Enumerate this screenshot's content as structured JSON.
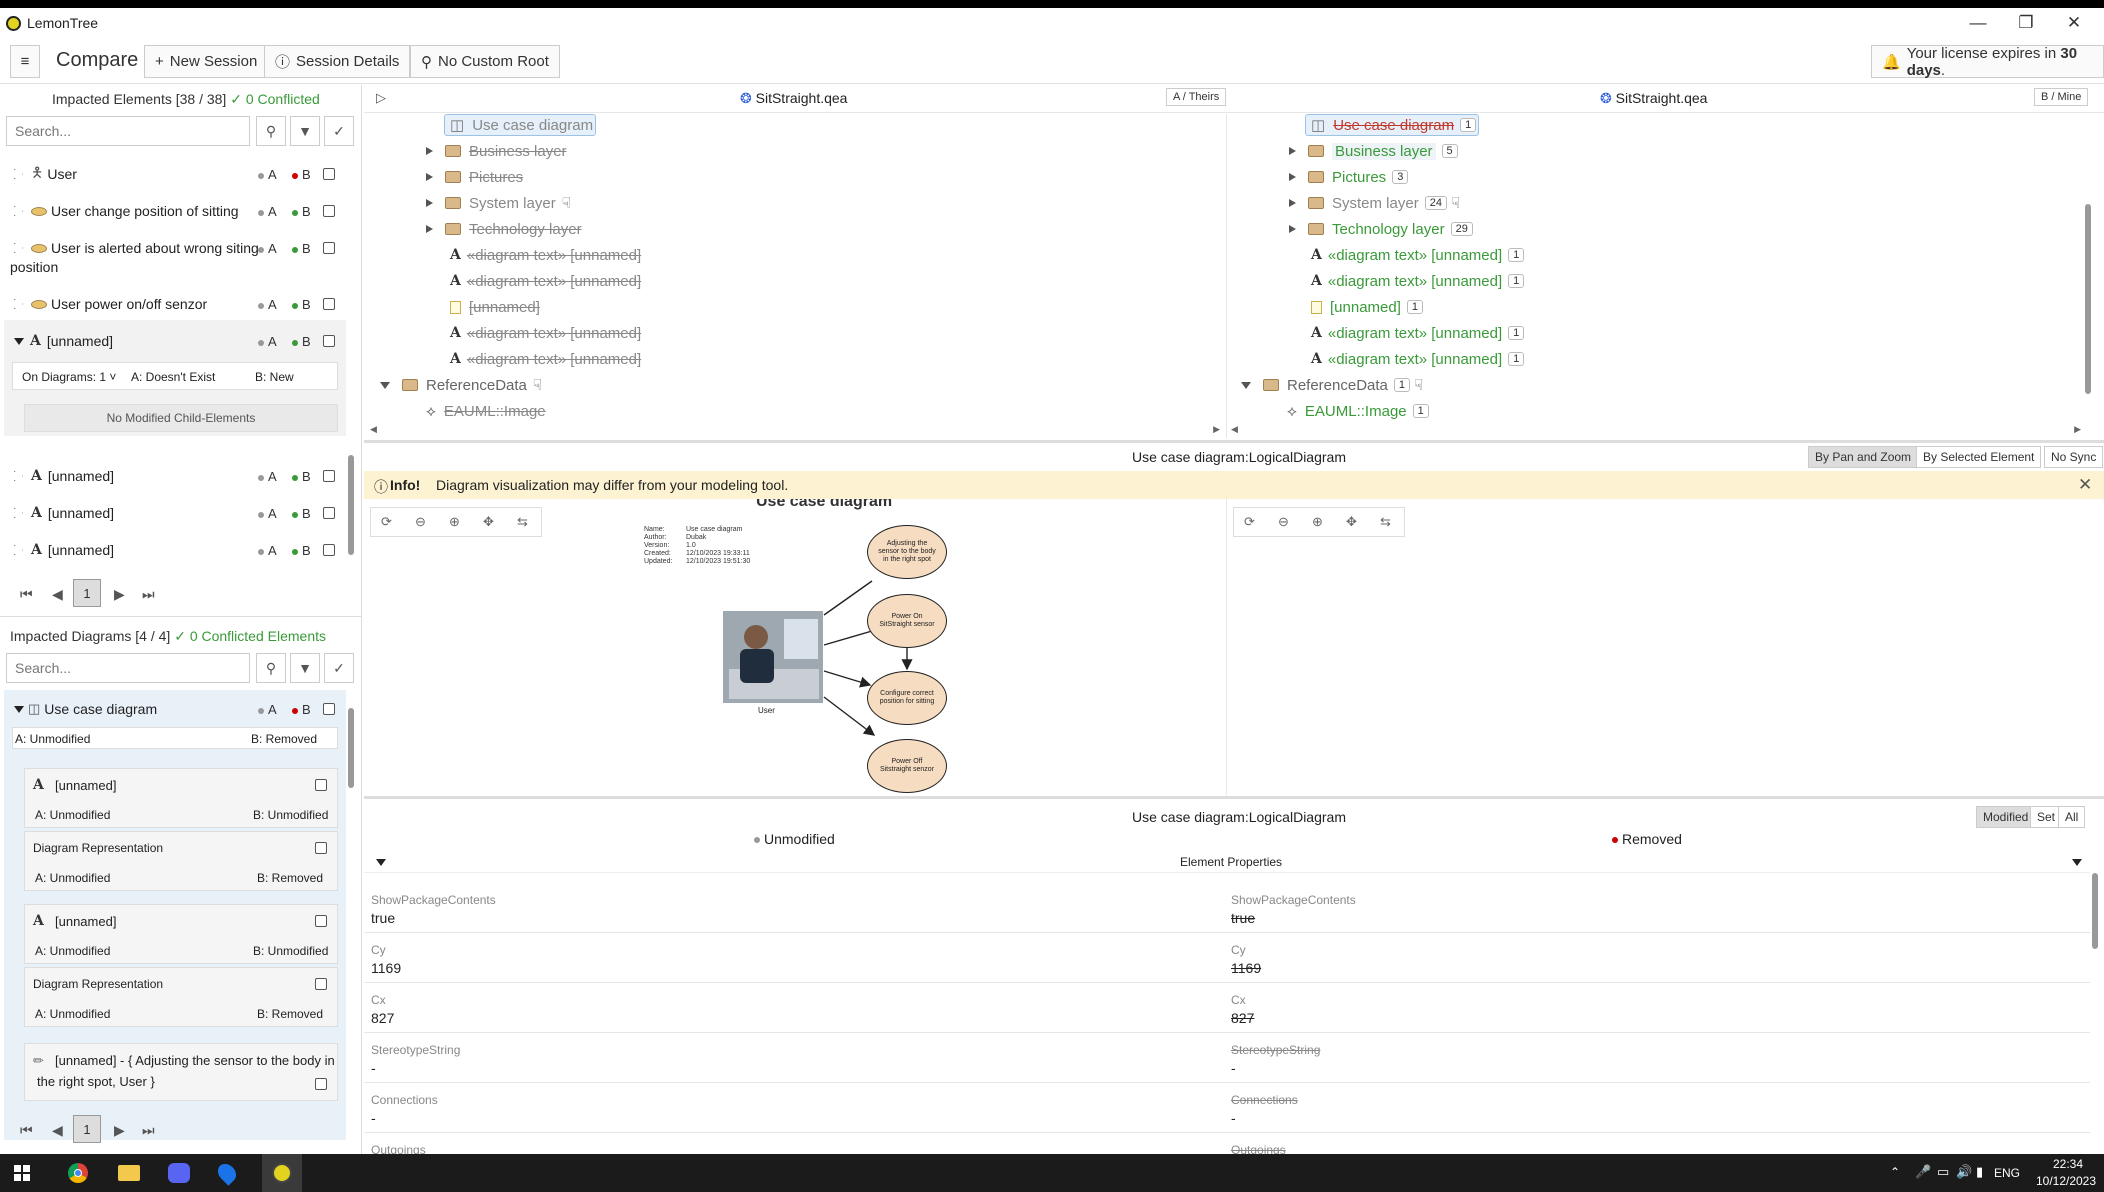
{
  "window": {
    "title": "LemonTree"
  },
  "toolbar": {
    "menu_icon": "hamburger-icon",
    "compare_label": "Compare",
    "new_session_label": "New Session",
    "session_details_label": "Session Details",
    "no_custom_root_label": "No Custom Root",
    "license_prefix": "Your license expires in ",
    "license_days": "30 days",
    "license_suffix": "."
  },
  "elements_panel": {
    "title": "Impacted Elements [38 / 38]",
    "conflicted": "0 Conflicted",
    "search_placeholder": "Search...",
    "items": [
      {
        "name": "User",
        "a": "A",
        "b": "B",
        "b_status": "removed"
      },
      {
        "name": "User change position of sitting",
        "a": "A",
        "b": "B",
        "b_status": "added"
      },
      {
        "name": "User is alerted about wrong siting",
        "name2": "position",
        "a": "A",
        "b": "B",
        "b_status": "added"
      },
      {
        "name": "User power on/off senzor",
        "a": "A",
        "b": "B",
        "b_status": "added"
      },
      {
        "name": "[unnamed]",
        "a": "A",
        "b": "B",
        "b_status": "added"
      }
    ],
    "detail": {
      "on_diagrams": "On Diagrams: 1",
      "a_state": "A: Doesn't Exist",
      "b_state": "B: New",
      "no_children": "No Modified Child-Elements"
    },
    "items2": [
      {
        "name": "[unnamed]",
        "a": "A",
        "b": "B"
      },
      {
        "name": "[unnamed]",
        "a": "A",
        "b": "B"
      },
      {
        "name": "[unnamed]",
        "a": "A",
        "b": "B"
      }
    ],
    "page": "1"
  },
  "diagrams_panel": {
    "title": "Impacted Diagrams [4 / 4]",
    "conflicted": "0 Conflicted Elements",
    "search_placeholder": "Search...",
    "diagram": {
      "name": "Use case diagram",
      "a": "A",
      "b": "B",
      "a_state": "A: Unmodified",
      "b_state": "B: Removed"
    },
    "subitems": [
      {
        "name": "[unnamed]",
        "a_state": "A: Unmodified",
        "b_state": "B: Unmodified"
      },
      {
        "name": "Diagram Representation",
        "a_state": "A: Unmodified",
        "b_state": "B: Removed"
      },
      {
        "name": "[unnamed]",
        "a_state": "A: Unmodified",
        "b_state": "B: Unmodified"
      },
      {
        "name": "Diagram Representation",
        "a_state": "A: Unmodified",
        "b_state": "B: Removed"
      },
      {
        "name": "[unnamed] - { Adjusting the sensor to the body in",
        "name2": "the right spot, User }"
      }
    ],
    "page": "1"
  },
  "left_tree": {
    "file": "SitStraight.qea",
    "tag": "A / Theirs",
    "items": [
      {
        "label": "Use case diagram"
      },
      {
        "label": "Business layer"
      },
      {
        "label": "Pictures"
      },
      {
        "label": "System layer"
      },
      {
        "label": "Technology layer"
      },
      {
        "label": "«diagram text» [unnamed]"
      },
      {
        "label": "«diagram text» [unnamed]"
      },
      {
        "label": "[unnamed]"
      },
      {
        "label": "«diagram text» [unnamed]"
      },
      {
        "label": "«diagram text» [unnamed]"
      },
      {
        "label": "ReferenceData"
      },
      {
        "label": "EAUML::Image"
      }
    ]
  },
  "right_tree": {
    "file": "SitStraight.qea",
    "tag": "B / Mine",
    "items": [
      {
        "label": "Use case diagram",
        "count": "1"
      },
      {
        "label": "Business layer",
        "count": "5"
      },
      {
        "label": "Pictures",
        "count": "3"
      },
      {
        "label": "System layer",
        "count": "24"
      },
      {
        "label": "Technology layer",
        "count": "29"
      },
      {
        "label": "«diagram text» [unnamed]",
        "count": "1"
      },
      {
        "label": "«diagram text» [unnamed]",
        "count": "1"
      },
      {
        "label": "[unnamed]",
        "count": "1"
      },
      {
        "label": "«diagram text» [unnamed]",
        "count": "1"
      },
      {
        "label": "«diagram text» [unnamed]",
        "count": "1"
      },
      {
        "label": "ReferenceData",
        "count": "1"
      },
      {
        "label": "EAUML::Image",
        "count": "1"
      }
    ]
  },
  "diagram_view": {
    "title": "Use case diagram:LogicalDiagram",
    "sync_options": [
      "By Pan and Zoom",
      "By Selected Element",
      "No Sync"
    ],
    "info_label": "Info!",
    "info_text": "Diagram visualization may differ from your modeling tool.",
    "diagram_title": "Use case diagram",
    "meta": [
      {
        "k": "Name:",
        "v": "Use case diagram"
      },
      {
        "k": "Author:",
        "v": "Dubak"
      },
      {
        "k": "Version:",
        "v": "1.0"
      },
      {
        "k": "Created:",
        "v": "12/10/2023 19:33:11"
      },
      {
        "k": "Updated:",
        "v": "12/10/2023 19:51:30"
      }
    ],
    "actor": "User",
    "usecases": [
      "Adjusting the sensor to the body in the right spot",
      "Power On SitStraight sensor",
      "Configure correct position for sitting",
      "Power Off Sitstraight senzor"
    ]
  },
  "properties": {
    "title": "Use case diagram:LogicalDiagram",
    "filter_options": [
      "Modified",
      "Set",
      "All"
    ],
    "left_status": "Unmodified",
    "right_status": "Removed",
    "section": "Element Properties",
    "rows": [
      {
        "name": "ShowPackageContents",
        "left": "true",
        "right": "true"
      },
      {
        "name": "Cy",
        "left": "1169",
        "right": "1169"
      },
      {
        "name": "Cx",
        "left": "827",
        "right": "827"
      },
      {
        "name": "StereotypeString",
        "left": "-",
        "right": "-"
      },
      {
        "name": "Connections",
        "left": "-",
        "right": "-"
      },
      {
        "name": "Outgoings",
        "left": "",
        "right": ""
      }
    ]
  },
  "taskbar": {
    "lang": "ENG",
    "time": "22:34",
    "date": "10/12/2023",
    "apps": [
      "windows-start-icon",
      "chrome-icon",
      "file-explorer-icon",
      "discord-icon",
      "maps-icon",
      "lemontree-icon"
    ]
  }
}
